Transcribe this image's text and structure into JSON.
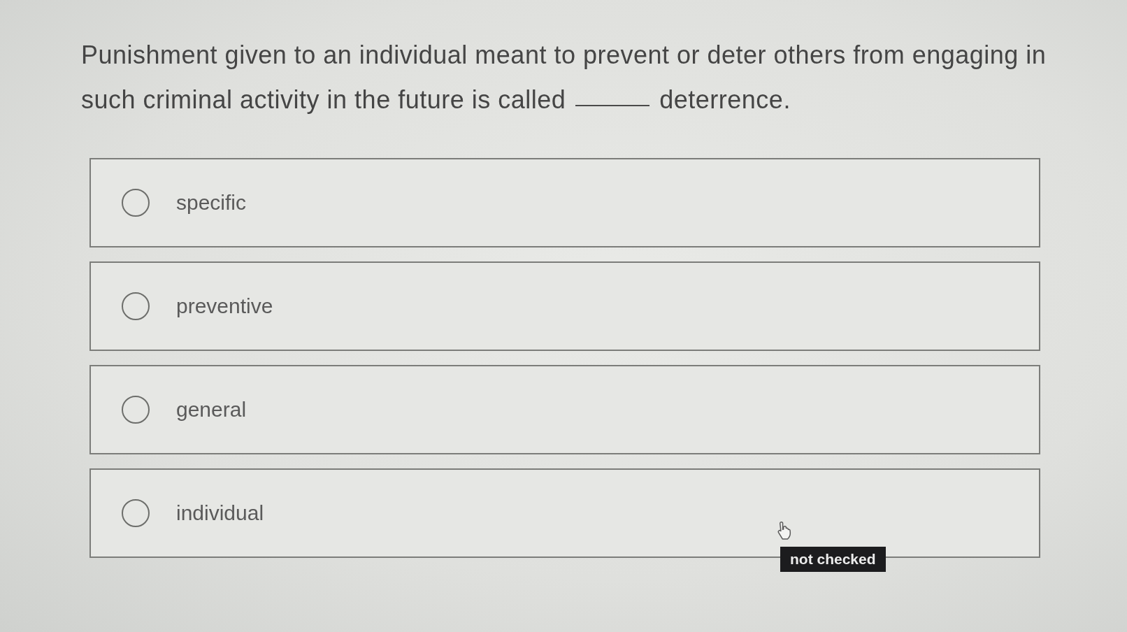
{
  "question": {
    "lines": [
      [
        {
          "kind": "text",
          "text": "Punishment given to an individual meant to prevent or deter others from engaging in"
        }
      ],
      [
        {
          "kind": "text",
          "text": "such criminal activity in the future is called"
        },
        {
          "kind": "blank"
        },
        {
          "kind": "text",
          "text": "deterrence."
        }
      ]
    ]
  },
  "options": [
    {
      "label": "specific",
      "selected": false
    },
    {
      "label": "preventive",
      "selected": false
    },
    {
      "label": "general",
      "selected": false
    },
    {
      "label": "individual",
      "selected": false,
      "tooltip": "not checked"
    }
  ]
}
